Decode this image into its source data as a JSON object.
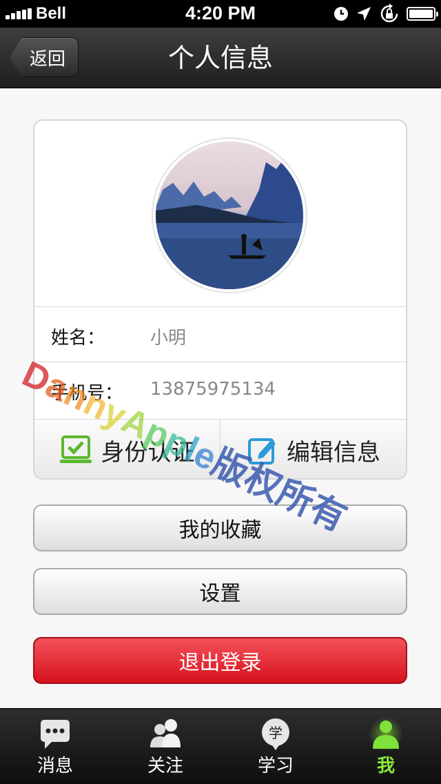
{
  "status_bar": {
    "carrier": "Bell",
    "time": "4:20 PM"
  },
  "nav": {
    "back_label": "返回",
    "title": "个人信息"
  },
  "profile": {
    "name_label": "姓名：",
    "name_value": "小明",
    "phone_label": "手机号：",
    "phone_value": "13875975134",
    "verify_label": "身份认证",
    "edit_label": "编辑信息"
  },
  "buttons": {
    "favorites": "我的收藏",
    "settings": "设置",
    "logout": "退出登录"
  },
  "watermark": {
    "latin": "DannyApple",
    "cjk": "版权所有"
  },
  "tabs": [
    {
      "label": "消息",
      "icon": "chat-bubble-icon"
    },
    {
      "label": "关注",
      "icon": "people-icon"
    },
    {
      "label": "学习",
      "icon": "study-icon",
      "badge": "学"
    },
    {
      "label": "我",
      "icon": "person-icon",
      "active": true
    }
  ],
  "colors": {
    "accent_active": "#8bea3c",
    "logout_red": "#d6121e",
    "verify_green": "#5cb82e",
    "edit_blue": "#2a9ad8"
  }
}
